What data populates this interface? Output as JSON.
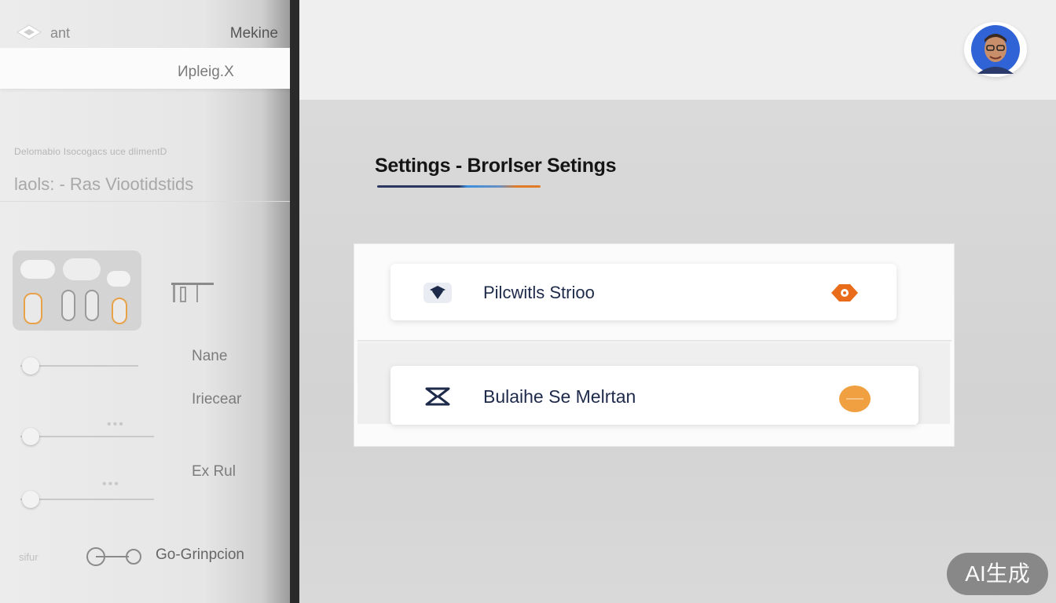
{
  "sidebar": {
    "app_name": "ant",
    "top_right_label": "Mekine",
    "tab_label": "Иpleig.X",
    "caption": "Delomabio Isocogacs uce dlimentD",
    "heading": "laols: - Ras Viootidstids",
    "labels": {
      "name": "Nane",
      "recent": "Iriecear",
      "extra": "Ex Rul",
      "bottom_small": "sifur",
      "bottom": "Go-Grinpcion"
    },
    "dots": [
      "•••",
      "•••"
    ]
  },
  "main": {
    "page_title": "Settings - Brorlser Setings",
    "cards": [
      {
        "label": "Pilcwitls Strioo",
        "left_icon": "shield-icon",
        "right_icon": "orange-eye-icon"
      },
      {
        "label": "Bulaihe Se Melrtan",
        "left_icon": "hourglass-icon",
        "right_icon": "orange-toggle-icon"
      }
    ]
  },
  "colors": {
    "accent_orange": "#e86c1a",
    "toggle_orange": "#f0a040",
    "navy": "#1e2a4a",
    "divider": "#2a2a2a"
  },
  "watermark": "AI生成"
}
